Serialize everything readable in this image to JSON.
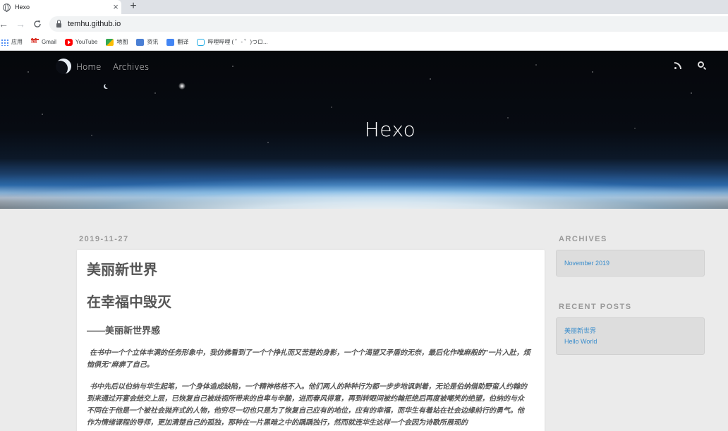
{
  "browser": {
    "tab_title": "Hexo",
    "tab_close": "×",
    "new_tab": "+",
    "back": "←",
    "forward": "→",
    "reload": "C",
    "url": "temhu.github.io",
    "bookmarks": [
      {
        "label": "应用",
        "icon": "apps-icon"
      },
      {
        "label": "Gmail",
        "icon": "gmail-icon"
      },
      {
        "label": "YouTube",
        "icon": "youtube-icon"
      },
      {
        "label": "地图",
        "icon": "maps-icon"
      },
      {
        "label": "资讯",
        "icon": "news-icon"
      },
      {
        "label": "翻译",
        "icon": "translate-icon"
      },
      {
        "label": "哔哩哔哩 ( ゜- ゜)つロ...",
        "icon": "bilibili-icon"
      }
    ]
  },
  "site": {
    "nav": [
      {
        "label": "Home"
      },
      {
        "label": "Archives"
      }
    ],
    "title": "Hexo"
  },
  "post": {
    "date": "2019-11-27",
    "title": "美丽新世界",
    "subtitle": "在幸福中毁灭",
    "byline": "——美丽新世界感",
    "paragraphs": [
      "在书中一个个立体丰满的任务形象中，我仿佛看到了一个个挣扎而又苦楚的身影，一个个渴望又矛盾的无奈，最后化作唯麻般的\"一片入肚，烦恼俱无\"麻痹了自己。",
      "书中先后以伯纳与华生起笔，一个身体造成缺陷，一个精神格格不入。他们两人的种种行为都一步步地讽刺着，无论是伯纳借助野蛮人约翰的到来通过开宴会结交上层，已恢复自己被歧视所带来的自卑与辛酸，进而春风得意，再到转眼间被约翰拒绝后再度被嘲笑的绝望，伯纳的与众不同在于他是一个被社会抛弃式的人物，他穷尽一切也只是为了恢复自己应有的地位，应有的幸福，而华生有着站在社会边缘前行的勇气。他作为情绪课程的导师，更加清楚自己的孤独，那种在一片黑暗之中的踽踽独行，然而就连华生这样一个会因为诗歌所展现的"
    ]
  },
  "sidebar": {
    "archives_title": "ARCHIVES",
    "archives": [
      "November 2019"
    ],
    "recent_title": "RECENT POSTS",
    "recent": [
      "美丽新世界",
      "Hello World"
    ]
  }
}
